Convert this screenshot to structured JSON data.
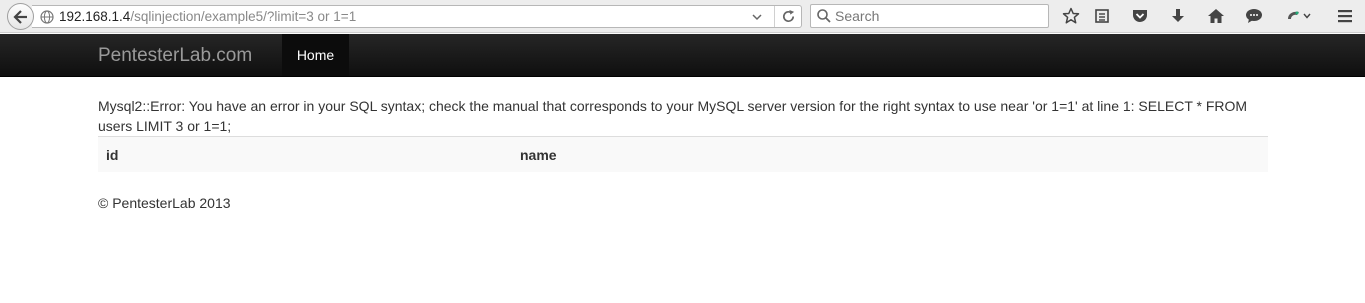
{
  "browser": {
    "url_host": "192.168.1.4",
    "url_path": "/sqlinjection/example5/?limit=3 or 1=1",
    "search_placeholder": "Search",
    "icons": [
      "back-arrow-icon",
      "globe-icon",
      "dropdown-arrow-icon",
      "reload-icon",
      "search-icon",
      "bookmark-star-icon",
      "reading-list-icon",
      "pocket-icon",
      "download-icon",
      "home-icon",
      "chat-icon",
      "extension-icon",
      "menu-icon"
    ]
  },
  "navbar": {
    "brand": "PentesterLab.com",
    "home_label": "Home"
  },
  "content": {
    "error_message": "Mysql2::Error: You have an error in your SQL syntax; check the manual that corresponds to your MySQL server version for the right syntax to use near 'or 1=1' at line 1: SELECT * FROM users LIMIT 3 or 1=1;",
    "table": {
      "columns": [
        "id",
        "name"
      ]
    }
  },
  "footer": {
    "text": "© PentesterLab 2013"
  }
}
